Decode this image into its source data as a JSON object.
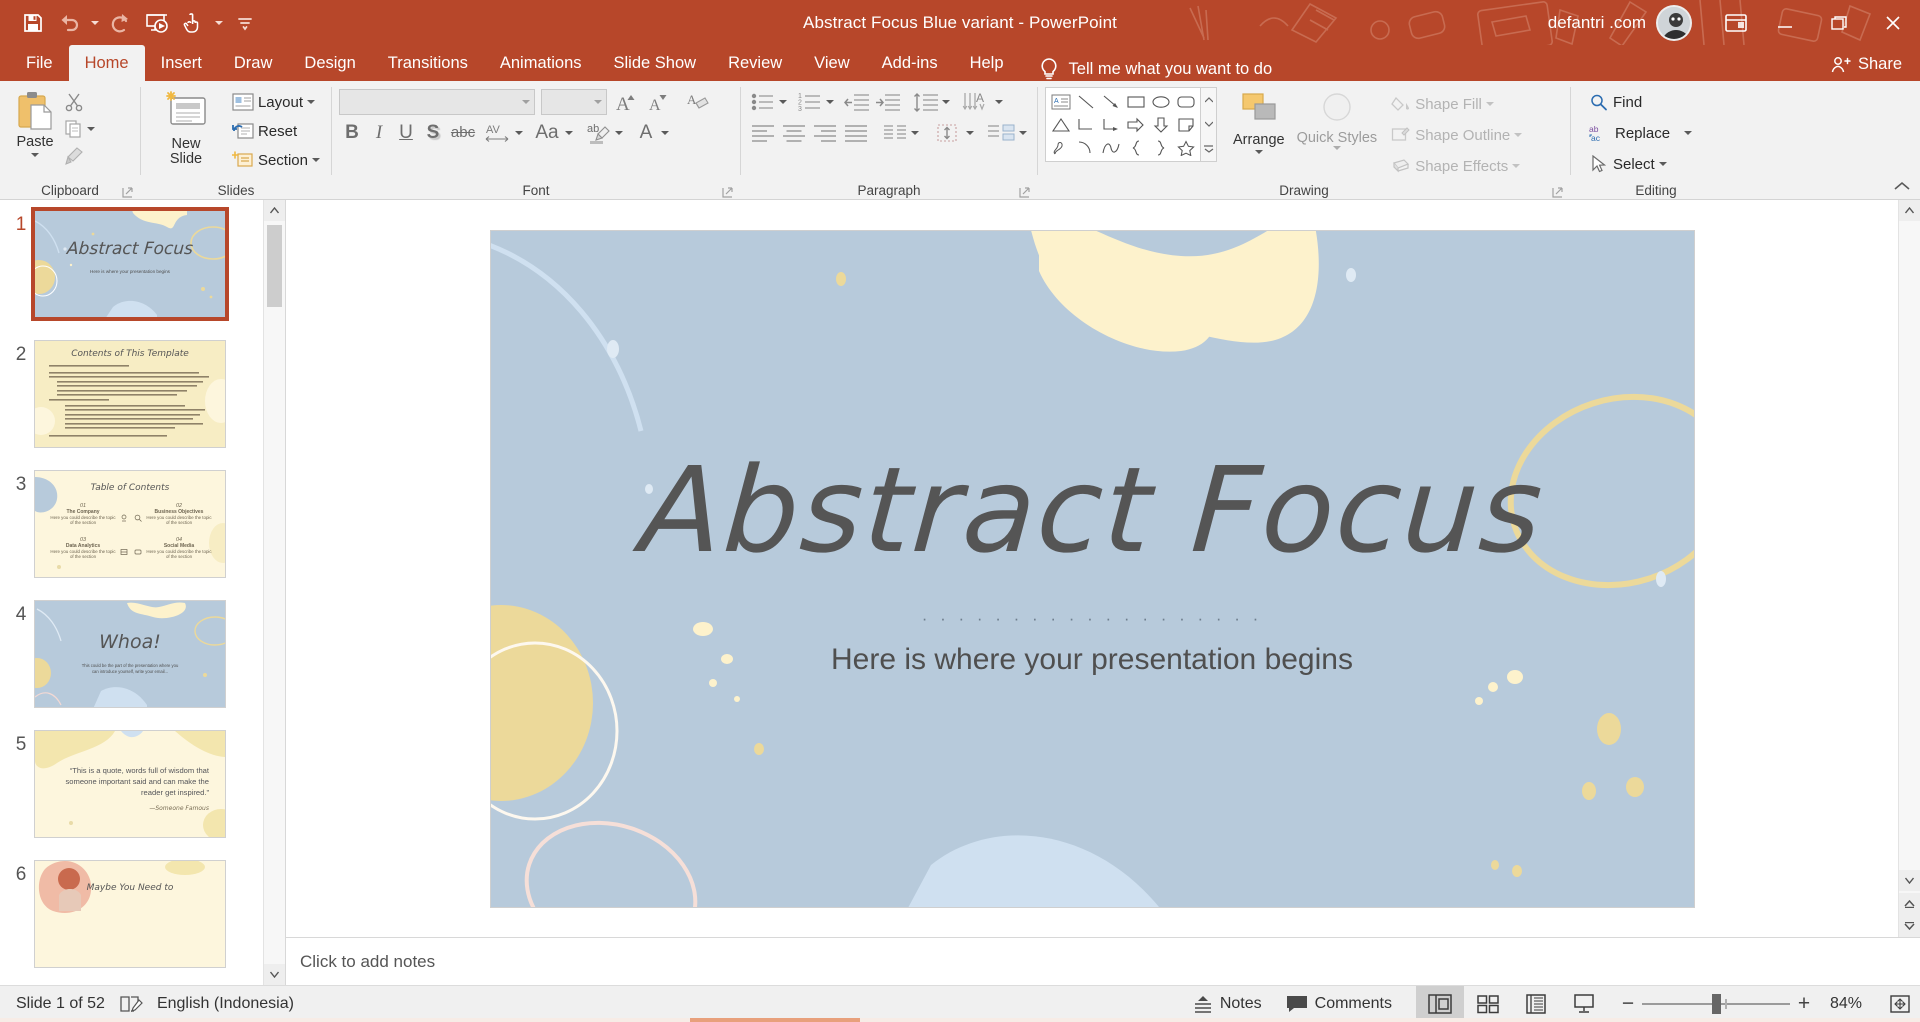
{
  "titlebar": {
    "title": "Abstract Focus Blue variant  -  PowerPoint",
    "account": "defantri .com",
    "qat": [
      {
        "name": "save",
        "label": "Save"
      },
      {
        "name": "undo",
        "label": "Undo"
      },
      {
        "name": "redo",
        "label": "Redo"
      },
      {
        "name": "start-from-beginning",
        "label": "Start From Beginning"
      },
      {
        "name": "touch-mouse-mode",
        "label": "Touch/Mouse Mode"
      },
      {
        "name": "customize-quick-access-toolbar",
        "label": "Customize Quick Access Toolbar"
      }
    ],
    "window": {
      "ribbon_display_options": "Ribbon Display Options",
      "minimize": "Minimize",
      "restore": "Restore Down",
      "close": "Close"
    }
  },
  "tabs": [
    {
      "label": "File",
      "active": false
    },
    {
      "label": "Home",
      "active": true
    },
    {
      "label": "Insert",
      "active": false
    },
    {
      "label": "Draw",
      "active": false
    },
    {
      "label": "Design",
      "active": false
    },
    {
      "label": "Transitions",
      "active": false
    },
    {
      "label": "Animations",
      "active": false
    },
    {
      "label": "Slide Show",
      "active": false
    },
    {
      "label": "Review",
      "active": false
    },
    {
      "label": "View",
      "active": false
    },
    {
      "label": "Add-ins",
      "active": false
    },
    {
      "label": "Help",
      "active": false
    }
  ],
  "tell_me": "Tell me what you want to do",
  "share": "Share",
  "ribbon": {
    "groups": [
      {
        "name": "clipboard",
        "label": "Clipboard"
      },
      {
        "name": "slides",
        "label": "Slides"
      },
      {
        "name": "font",
        "label": "Font"
      },
      {
        "name": "paragraph",
        "label": "Paragraph"
      },
      {
        "name": "drawing",
        "label": "Drawing"
      },
      {
        "name": "editing",
        "label": "Editing"
      }
    ],
    "clipboard": {
      "paste": "Paste",
      "cut": "Cut",
      "copy": "Copy",
      "format_painter": "Format Painter"
    },
    "slides": {
      "new_slide": "New\nSlide",
      "new_slide_label": "New Slide",
      "layout": "Layout",
      "reset": "Reset",
      "section": "Section"
    },
    "font": {
      "font_name_value": "",
      "font_name_placeholder": "",
      "font_size_value": "",
      "increase_font": "Increase Font Size",
      "decrease_font": "Decrease Font Size",
      "clear_formatting": "Clear All Formatting",
      "bold": "B",
      "italic": "I",
      "underline": "U",
      "shadow": "S",
      "strikethrough": "abc",
      "character_spacing": "AV",
      "change_case": "Aa",
      "text_highlight": "ab",
      "font_color": "A"
    },
    "paragraph": {
      "bullets": "Bullets",
      "numbering": "Numbering",
      "decrease_indent": "Decrease List Level",
      "increase_indent": "Increase List Level",
      "line_spacing": "Line Spacing",
      "align_left": "Align Left",
      "align_center": "Center",
      "align_right": "Align Right",
      "justify": "Justify",
      "columns": "Columns",
      "text_direction": "Text Direction",
      "align_text": "Align Text",
      "convert_smartart": "Convert to SmartArt"
    },
    "drawing": {
      "arrange": "Arrange",
      "quick_styles": "Quick\nStyles",
      "quick_styles_label": "Quick Styles",
      "shape_fill": "Shape Fill",
      "shape_outline": "Shape Outline",
      "shape_effects": "Shape Effects"
    },
    "editing": {
      "find": "Find",
      "replace": "Replace",
      "select": "Select"
    }
  },
  "slides_panel": {
    "slides": [
      {
        "number": "1",
        "title": "Abstract Focus",
        "subtitle": "Here is where your presentation begins",
        "theme": "blue",
        "selected": true
      },
      {
        "number": "2",
        "title": "Contents of This Template",
        "theme": "cream",
        "selected": false
      },
      {
        "number": "3",
        "title": "Table of Contents",
        "theme": "cream",
        "selected": false
      },
      {
        "number": "4",
        "title": "Whoa!",
        "subtitle": "This could be the part of the presentation where you can introduce yourself, write your email...",
        "theme": "blue",
        "selected": false
      },
      {
        "number": "5",
        "title": "“This is a quote, words full of wisdom that someone important said and can make the reader get inspired.”",
        "attribution": "—Someone Famous",
        "theme": "cream",
        "selected": false
      },
      {
        "number": "6",
        "title": "Maybe You Need to",
        "theme": "photo",
        "selected": false
      }
    ],
    "toc_items": [
      {
        "num": "01",
        "title": "The Company",
        "desc": "Here you could describe the topic of the section"
      },
      {
        "num": "02",
        "title": "Business Objectives",
        "desc": "Here you could describe the topic of the section"
      },
      {
        "num": "03",
        "title": "Data Analytics",
        "desc": "Here you could describe the topic of the section"
      },
      {
        "num": "04",
        "title": "Social Media",
        "desc": "Here you could describe the topic of the section"
      }
    ]
  },
  "slide_canvas": {
    "title": "Abstract Focus",
    "divider": "· · · · · · · · · · · · · · · · · · ·",
    "subtitle": "Here is where your presentation begins"
  },
  "notes": {
    "placeholder": "Click to add notes"
  },
  "statusbar": {
    "slide_indicator": "Slide 1 of 52",
    "language": "English (Indonesia)",
    "notes_button": "Notes",
    "comments_button": "Comments",
    "views": [
      {
        "name": "normal-view",
        "label": "Normal",
        "active": true
      },
      {
        "name": "slide-sorter-view",
        "label": "Slide Sorter",
        "active": false
      },
      {
        "name": "reading-view",
        "label": "Reading View",
        "active": false
      },
      {
        "name": "slide-show-view",
        "label": "Slide Show",
        "active": false
      }
    ],
    "zoom_out": "−",
    "zoom_in": "+",
    "zoom_level": "84%",
    "fit_to_window": "Fit slide to current window"
  },
  "colors": {
    "accent": "#b7472a",
    "ribbon_bg": "#f2f2f2",
    "slide_blue": "#b7cadb",
    "slide_cream": "#f7edc4",
    "title_text": "#555555",
    "yellow_shape": "#fdf2cc",
    "gold_shape": "#ecd99a",
    "light_blue_shape": "#cfe0f0"
  }
}
